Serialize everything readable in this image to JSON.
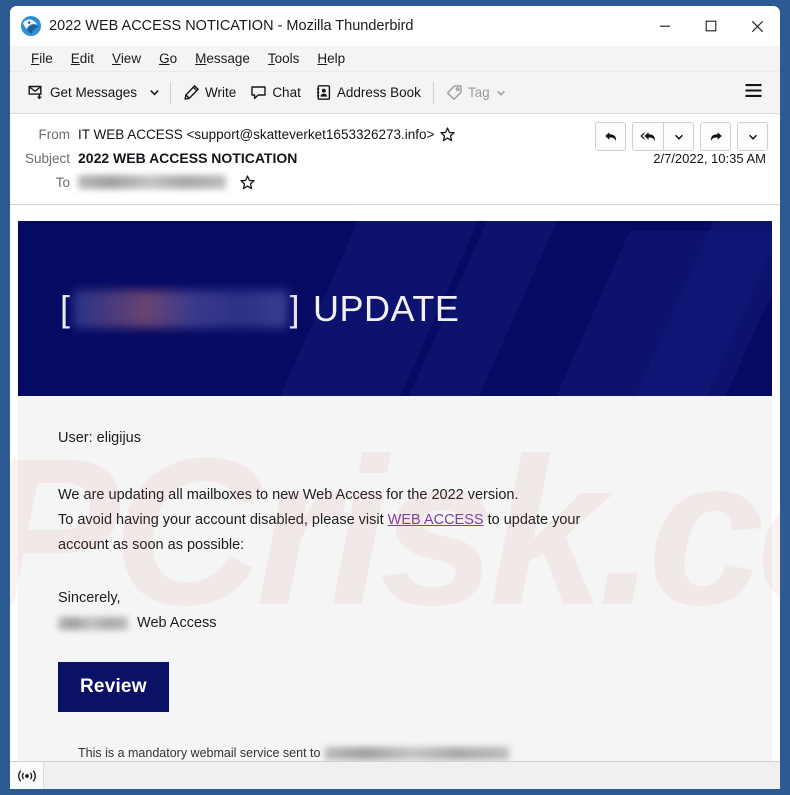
{
  "window": {
    "title": "2022 WEB ACCESS NOTICATION - Mozilla Thunderbird",
    "app_icon": "thunderbird-icon",
    "controls": {
      "minimize": "minimize-icon",
      "maximize": "maximize-icon",
      "close": "close-icon"
    },
    "frame_color": "#2b5b92"
  },
  "menubar": {
    "items": [
      {
        "accesskey": "F",
        "rest": "ile"
      },
      {
        "accesskey": "E",
        "rest": "dit"
      },
      {
        "accesskey": "V",
        "rest": "iew"
      },
      {
        "accesskey": "G",
        "rest": "o"
      },
      {
        "accesskey": "M",
        "rest": "essage"
      },
      {
        "accesskey": "T",
        "rest": "ools"
      },
      {
        "accesskey": "H",
        "rest": "elp"
      }
    ]
  },
  "toolbar": {
    "get_messages_label": "Get Messages",
    "write_label": "Write",
    "chat_label": "Chat",
    "address_book_label": "Address Book",
    "tag_label": "Tag",
    "tag_disabled": true,
    "menu_icon": "hamburger-icon"
  },
  "message_header": {
    "from_label": "From",
    "from_value": "IT WEB ACCESS <support@skatteverket1653326273.info>",
    "subject_label": "Subject",
    "subject_value": "2022 WEB ACCESS NOTICATION",
    "to_label": "To",
    "to_value_redacted": true,
    "date": "2/7/2022, 10:35 AM",
    "actions": [
      "reply-icon",
      "reply-all-icon",
      "reply-menu-chevron-icon",
      "forward-icon",
      "more-actions-chevron-icon"
    ]
  },
  "email": {
    "banner": {
      "bracket_open": "[",
      "redacted_brand": true,
      "bracket_close": "]",
      "title_suffix": "UPDATE",
      "background_color": "#060a63",
      "text_color": "#f0f0f5"
    },
    "user_line": "User: eligijus",
    "paragraph_line_1": "We are updating all mailboxes to new Web Access for the 2022 version.",
    "paragraph_line_2_before_link": "To avoid having your account disabled, please visit ",
    "link_text": "WEB ACCESS",
    "paragraph_line_2_after_link": " to update your",
    "paragraph_line_3": "account as soon as possible:",
    "signoff": "Sincerely,",
    "signature_suffix": "Web Access",
    "signature_name_redacted": true,
    "review_button_label": "Review",
    "review_button_color": "#0b1266",
    "link_color": "#7d3aa8",
    "footer_text": "This is a mandatory webmail service sent to",
    "footer_email_redacted": true
  },
  "watermark": {
    "line1": "PC",
    "line2": "risk.com"
  },
  "statusbar": {
    "icon": "broadcast-icon",
    "text": ""
  }
}
